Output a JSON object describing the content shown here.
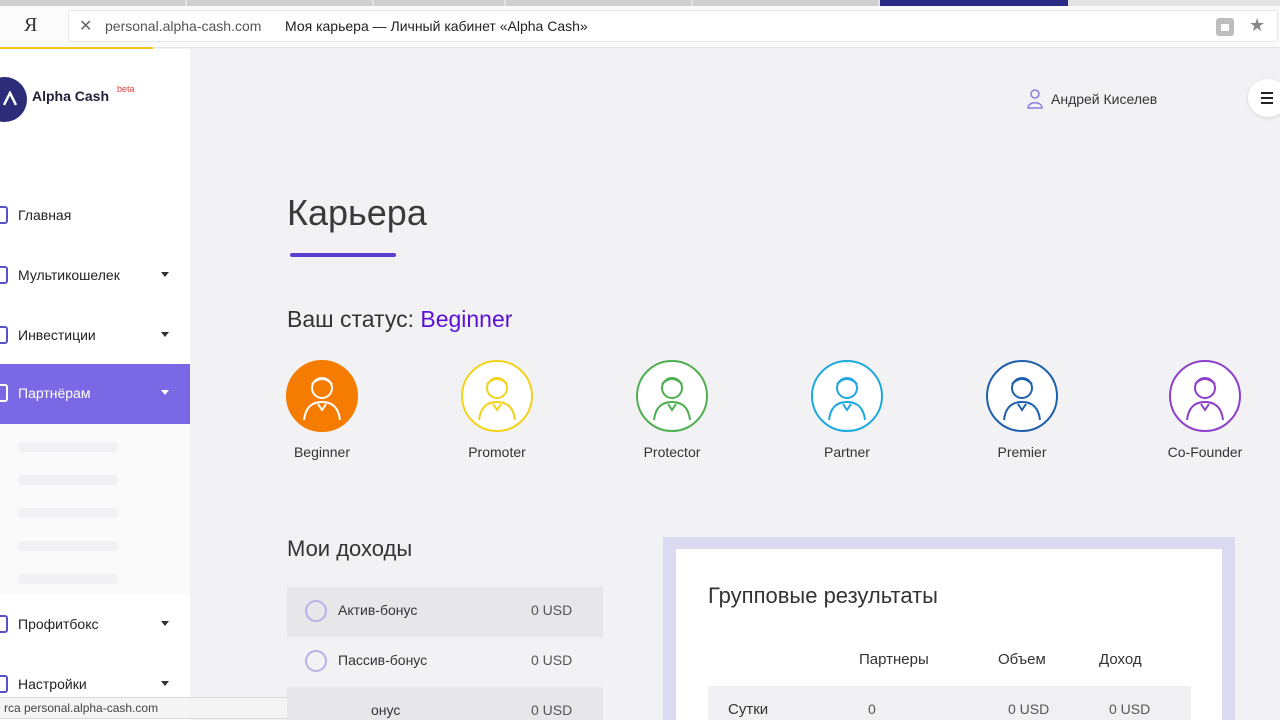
{
  "browser": {
    "yandex_logo": "Я",
    "close_symbol": "✕",
    "domain": "personal.alpha-cash.com",
    "page_title": "Моя карьера — Личный кабинет «Alpha Cash»",
    "star_symbol": "★"
  },
  "logo": {
    "name": "Alpha Cash",
    "beta": "beta"
  },
  "sidebar": {
    "items": [
      {
        "label": "Главная",
        "icon": "home-icon"
      },
      {
        "label": "Мультикошелек",
        "icon": "wallet-icon"
      },
      {
        "label": "Инвестиции",
        "icon": "investments-icon"
      },
      {
        "label": "Партнёрам",
        "icon": "partners-icon"
      },
      {
        "label": "Профитбокс",
        "icon": "profitbox-icon"
      },
      {
        "label": "Настройки",
        "icon": "settings-icon"
      }
    ]
  },
  "statusbar": {
    "text": "rca personal.alpha-cash.com"
  },
  "header": {
    "user_name": "Андрей Киселев",
    "menu_symbol": "☰"
  },
  "main": {
    "title": "Карьера",
    "status_label": "Ваш статус:",
    "status_value": "Beginner",
    "ranks": [
      {
        "label": "Beginner",
        "color": "#f57c00",
        "filled": true
      },
      {
        "label": "Promoter",
        "color": "#f2d21b",
        "filled": false
      },
      {
        "label": "Protector",
        "color": "#4caf50",
        "filled": false
      },
      {
        "label": "Partner",
        "color": "#1ea8e0",
        "filled": false
      },
      {
        "label": "Premier",
        "color": "#1e5fae",
        "filled": false
      },
      {
        "label": "Co-Founder",
        "color": "#8e3fc9",
        "filled": false
      }
    ],
    "incomes": {
      "title": "Мои доходы",
      "rows": [
        {
          "label": "Актив-бонус",
          "value": "0 USD"
        },
        {
          "label": "Пассив-бонус",
          "value": "0 USD"
        },
        {
          "label": "онус",
          "value": "0 USD"
        }
      ]
    },
    "group": {
      "title": "Групповые результаты",
      "headers": [
        "Партнеры",
        "Объем",
        "Доход"
      ],
      "rows": [
        {
          "period": "Сутки",
          "partners": "0",
          "volume": "0 USD",
          "income": "0 USD"
        }
      ]
    }
  }
}
